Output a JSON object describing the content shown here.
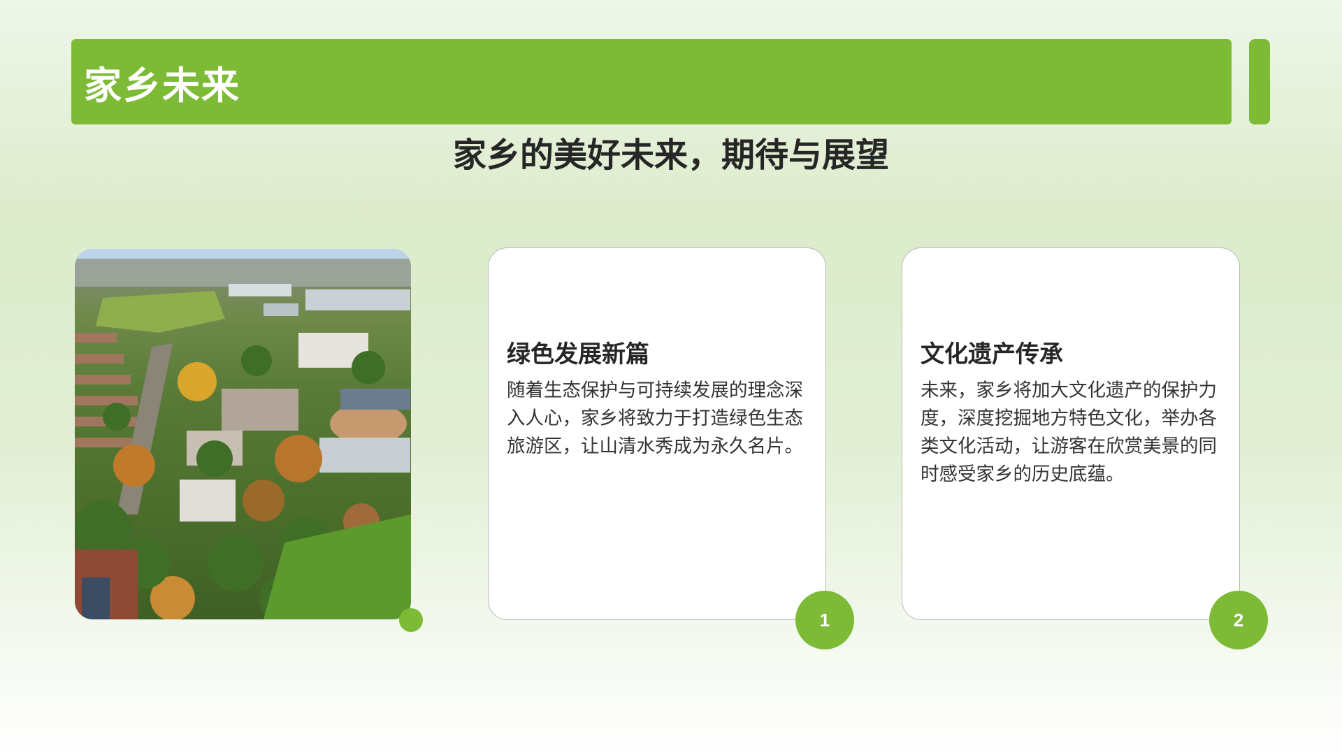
{
  "header": {
    "title": "家乡未来",
    "subtitle": "家乡的美好未来，期待与展望"
  },
  "photo": {
    "description_icon": "aerial-town-image"
  },
  "cards": [
    {
      "title": "绿色发展新篇",
      "body": "随着生态保护与可持续发展的理念深入人心，家乡将致力于打造绿色生态旅游区，让山清水秀成为永久名片。",
      "badge": "1"
    },
    {
      "title": "文化遗产传承",
      "body": "未来，家乡将加大文化遗产的保护力度，深度挖掘地方特色文化，举办各类文化活动，让游客在欣赏美景的同时感受家乡的历史底蕴。",
      "badge": "2"
    }
  ],
  "colors": {
    "accent": "#7dbb36",
    "text_dark": "#262626",
    "card_border": "#b5bdb0"
  }
}
